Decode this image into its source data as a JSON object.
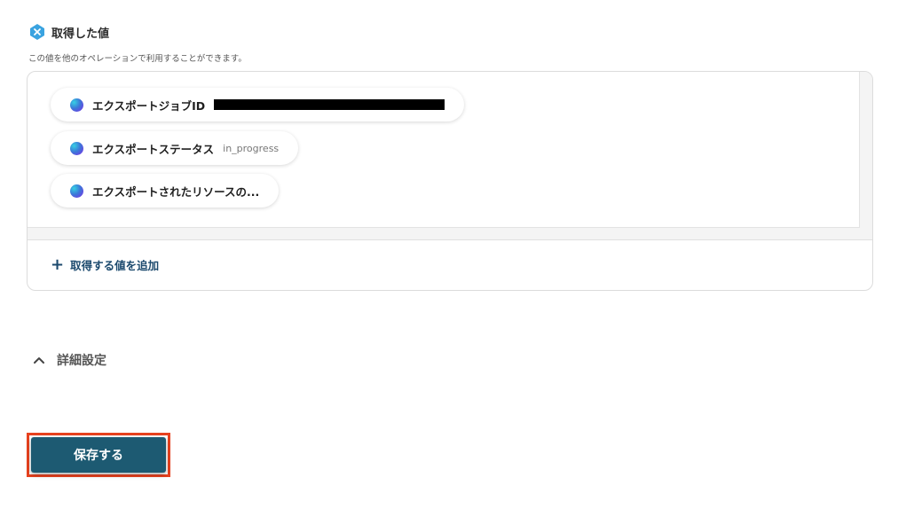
{
  "section": {
    "title": "取得した値",
    "description": "この値を他のオペレーションで利用することができます。",
    "icon": "x-badge-icon",
    "icon_color": "#3aa3e0"
  },
  "values": [
    {
      "label": "エクスポートジョブID",
      "value": "",
      "redacted": true
    },
    {
      "label": "エクスポートステータス",
      "value": "in_progress",
      "redacted": false
    },
    {
      "label": "エクスポートされたリソースの...",
      "value": "",
      "redacted": false
    }
  ],
  "chip_logo_text": "Canva",
  "add_value_label": "取得する値を追加",
  "advanced": {
    "label": "詳細設定",
    "icon": "chevron-up-icon"
  },
  "save_button": {
    "label": "保存する",
    "color": "#1d5a72",
    "highlight_color": "#e8421f"
  }
}
